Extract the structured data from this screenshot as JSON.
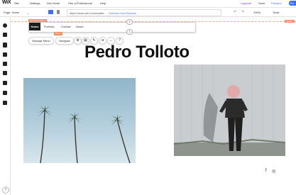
{
  "menubar": {
    "logo": "WiX",
    "items": [
      "Site",
      "Settings",
      "Dev Mode",
      "Hire a Professional",
      "Help"
    ],
    "upgrade": "Upgrade",
    "save": "Save",
    "preview": "Preview",
    "publish": "Pu"
  },
  "toolbar": {
    "page_select": "Page: Home",
    "url": "https://www.wix.com/mysite",
    "connect_domain": "Connect Your Domain",
    "zoom": "100%",
    "tools": "Tools"
  },
  "header": {
    "section_tag": "Horizontal Menu",
    "right_tag": "Header",
    "nav_items": [
      "Home",
      "Portfolio",
      "Contact",
      "About"
    ],
    "menu_tag": "Menu"
  },
  "actions": {
    "manage_menu": "Manage Menu",
    "navigate": "Navigate"
  },
  "title": "Pedro Tolloto",
  "social": {
    "fb": "f",
    "ig": "◎"
  },
  "colors": {
    "accent": "#3b70f5",
    "upgrade": "#8a4cf0",
    "tag": "#f58b5e",
    "nav_active": "#1d1d1d"
  },
  "icons": [
    "add-icon",
    "menu-icon",
    "pages-icon",
    "theme-icon",
    "apps-icon",
    "media-icon",
    "blog-icon",
    "settings-icon",
    "help-icon"
  ]
}
